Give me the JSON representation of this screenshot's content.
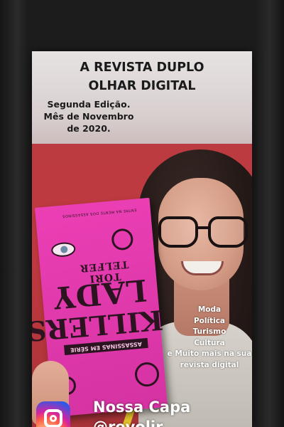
{
  "magazine": {
    "title_line1": "A REVISTA DUPLO",
    "title_line2": "OLHAR DIGITAL"
  },
  "edition": {
    "line1": "Segunda Edição.",
    "line2": "Mês de Novembro",
    "line3": "de 2020."
  },
  "book": {
    "top_text": "ENTRE NA MENTE DOS ASSASSINOS",
    "author": "TORI TELFER",
    "title_line1": "LADY",
    "title_line2": "KILLERS",
    "subtitle": "ASSASSINAS EM SÉRIE"
  },
  "topics": [
    "Moda",
    "Política",
    "Turismo",
    "Cultura",
    "e Muito mais na sua",
    "revista digital"
  ],
  "footer": {
    "label": "Nossa Capa",
    "handle": "@revolir"
  },
  "colors": {
    "book_pink": "#e13aad",
    "wall_red": "#c0393f",
    "title_text": "#1a1a1a",
    "overlay_text": "#ffffff"
  },
  "icons": [
    "instagram-icon"
  ]
}
